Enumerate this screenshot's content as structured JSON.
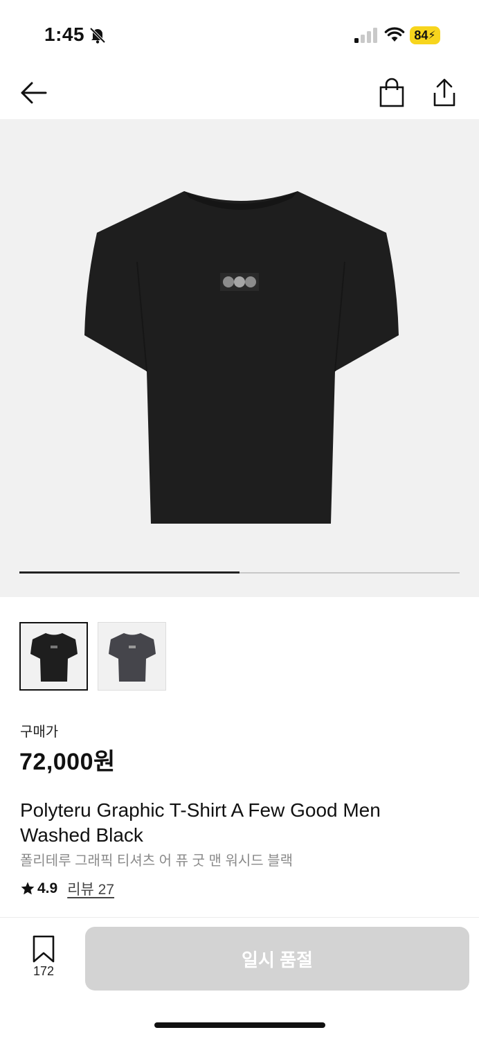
{
  "status_bar": {
    "time": "1:45",
    "battery": "84"
  },
  "icons": {
    "bell": "bell-off-icon",
    "signal": "cellular-signal-icon",
    "wifi": "wifi-icon",
    "back": "arrow-left-icon",
    "cart": "shopping-bag-icon",
    "share": "share-icon",
    "star": "star-icon",
    "bookmark": "bookmark-icon"
  },
  "gallery": {
    "image_count": 2,
    "current_index": 1,
    "progress_fraction": 0.5
  },
  "product": {
    "price_label": "구매가",
    "price": "72,000원",
    "title_en": "Polyteru Graphic T-Shirt A Few Good Men Washed Black",
    "title_ko": "폴리테루 그래픽 티셔츠 어 퓨 굿 맨 워시드 블랙",
    "rating": "4.9",
    "review_label": "리뷰 27"
  },
  "bottom_bar": {
    "bookmark_count": "172",
    "buy_button_label": "일시 품절"
  },
  "colors": {
    "accent_dark": "#111111",
    "disabled_button": "#d3d3d3",
    "battery_yellow": "#f7d51d",
    "image_background": "#f1f1f1"
  }
}
